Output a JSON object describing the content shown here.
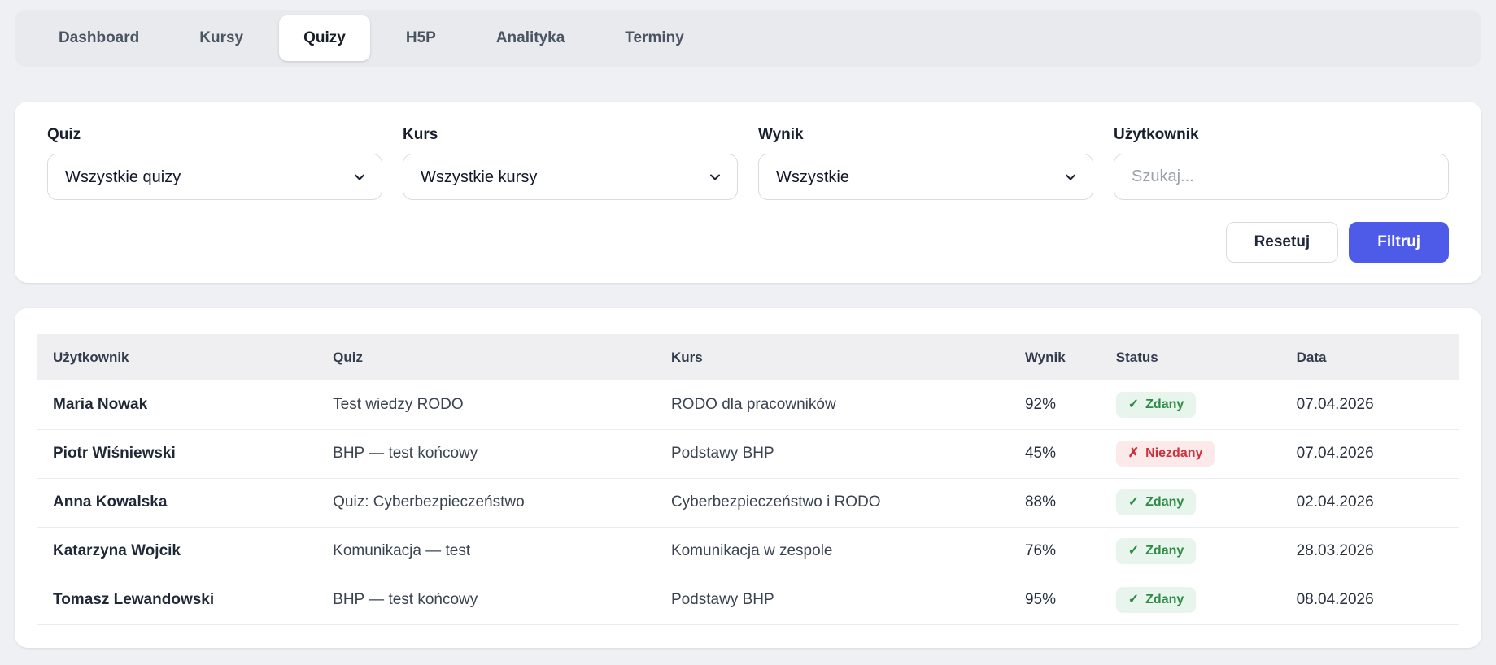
{
  "nav": {
    "tabs": [
      {
        "label": "Dashboard",
        "active": false
      },
      {
        "label": "Kursy",
        "active": false
      },
      {
        "label": "Quizy",
        "active": true
      },
      {
        "label": "H5P",
        "active": false
      },
      {
        "label": "Analityka",
        "active": false
      },
      {
        "label": "Terminy",
        "active": false
      }
    ]
  },
  "filters": {
    "quiz": {
      "label": "Quiz",
      "value": "Wszystkie quizy"
    },
    "kurs": {
      "label": "Kurs",
      "value": "Wszystkie kursy"
    },
    "wynik": {
      "label": "Wynik",
      "value": "Wszystkie"
    },
    "uzytkownik": {
      "label": "Użytkownik",
      "placeholder": "Szukaj..."
    },
    "reset_label": "Resetuj",
    "filter_label": "Filtruj"
  },
  "colors": {
    "accent": "#4d5be8",
    "pass_text": "#2e8b47",
    "pass_bg": "#e8f5ec",
    "fail_text": "#cd3140",
    "fail_bg": "#fce9e9"
  },
  "table": {
    "headers": [
      "Użytkownik",
      "Quiz",
      "Kurs",
      "Wynik",
      "Status",
      "Data"
    ],
    "rows": [
      {
        "user": "Maria Nowak",
        "quiz": "Test wiedzy RODO",
        "kurs": "RODO dla pracowników",
        "wynik": "92%",
        "status": {
          "icon": "✓",
          "label": "Zdany",
          "type": "pass"
        },
        "data": "07.04.2026"
      },
      {
        "user": "Piotr Wiśniewski",
        "quiz": "BHP — test końcowy",
        "kurs": "Podstawy BHP",
        "wynik": "45%",
        "status": {
          "icon": "✗",
          "label": "Niezdany",
          "type": "fail"
        },
        "data": "07.04.2026"
      },
      {
        "user": "Anna Kowalska",
        "quiz": "Quiz: Cyberbezpieczeństwo",
        "kurs": "Cyberbezpieczeństwo i RODO",
        "wynik": "88%",
        "status": {
          "icon": "✓",
          "label": "Zdany",
          "type": "pass"
        },
        "data": "02.04.2026"
      },
      {
        "user": "Katarzyna Wojcik",
        "quiz": "Komunikacja — test",
        "kurs": "Komunikacja w zespole",
        "wynik": "76%",
        "status": {
          "icon": "✓",
          "label": "Zdany",
          "type": "pass"
        },
        "data": "28.03.2026"
      },
      {
        "user": "Tomasz Lewandowski",
        "quiz": "BHP — test końcowy",
        "kurs": "Podstawy BHP",
        "wynik": "95%",
        "status": {
          "icon": "✓",
          "label": "Zdany",
          "type": "pass"
        },
        "data": "08.04.2026"
      }
    ]
  }
}
